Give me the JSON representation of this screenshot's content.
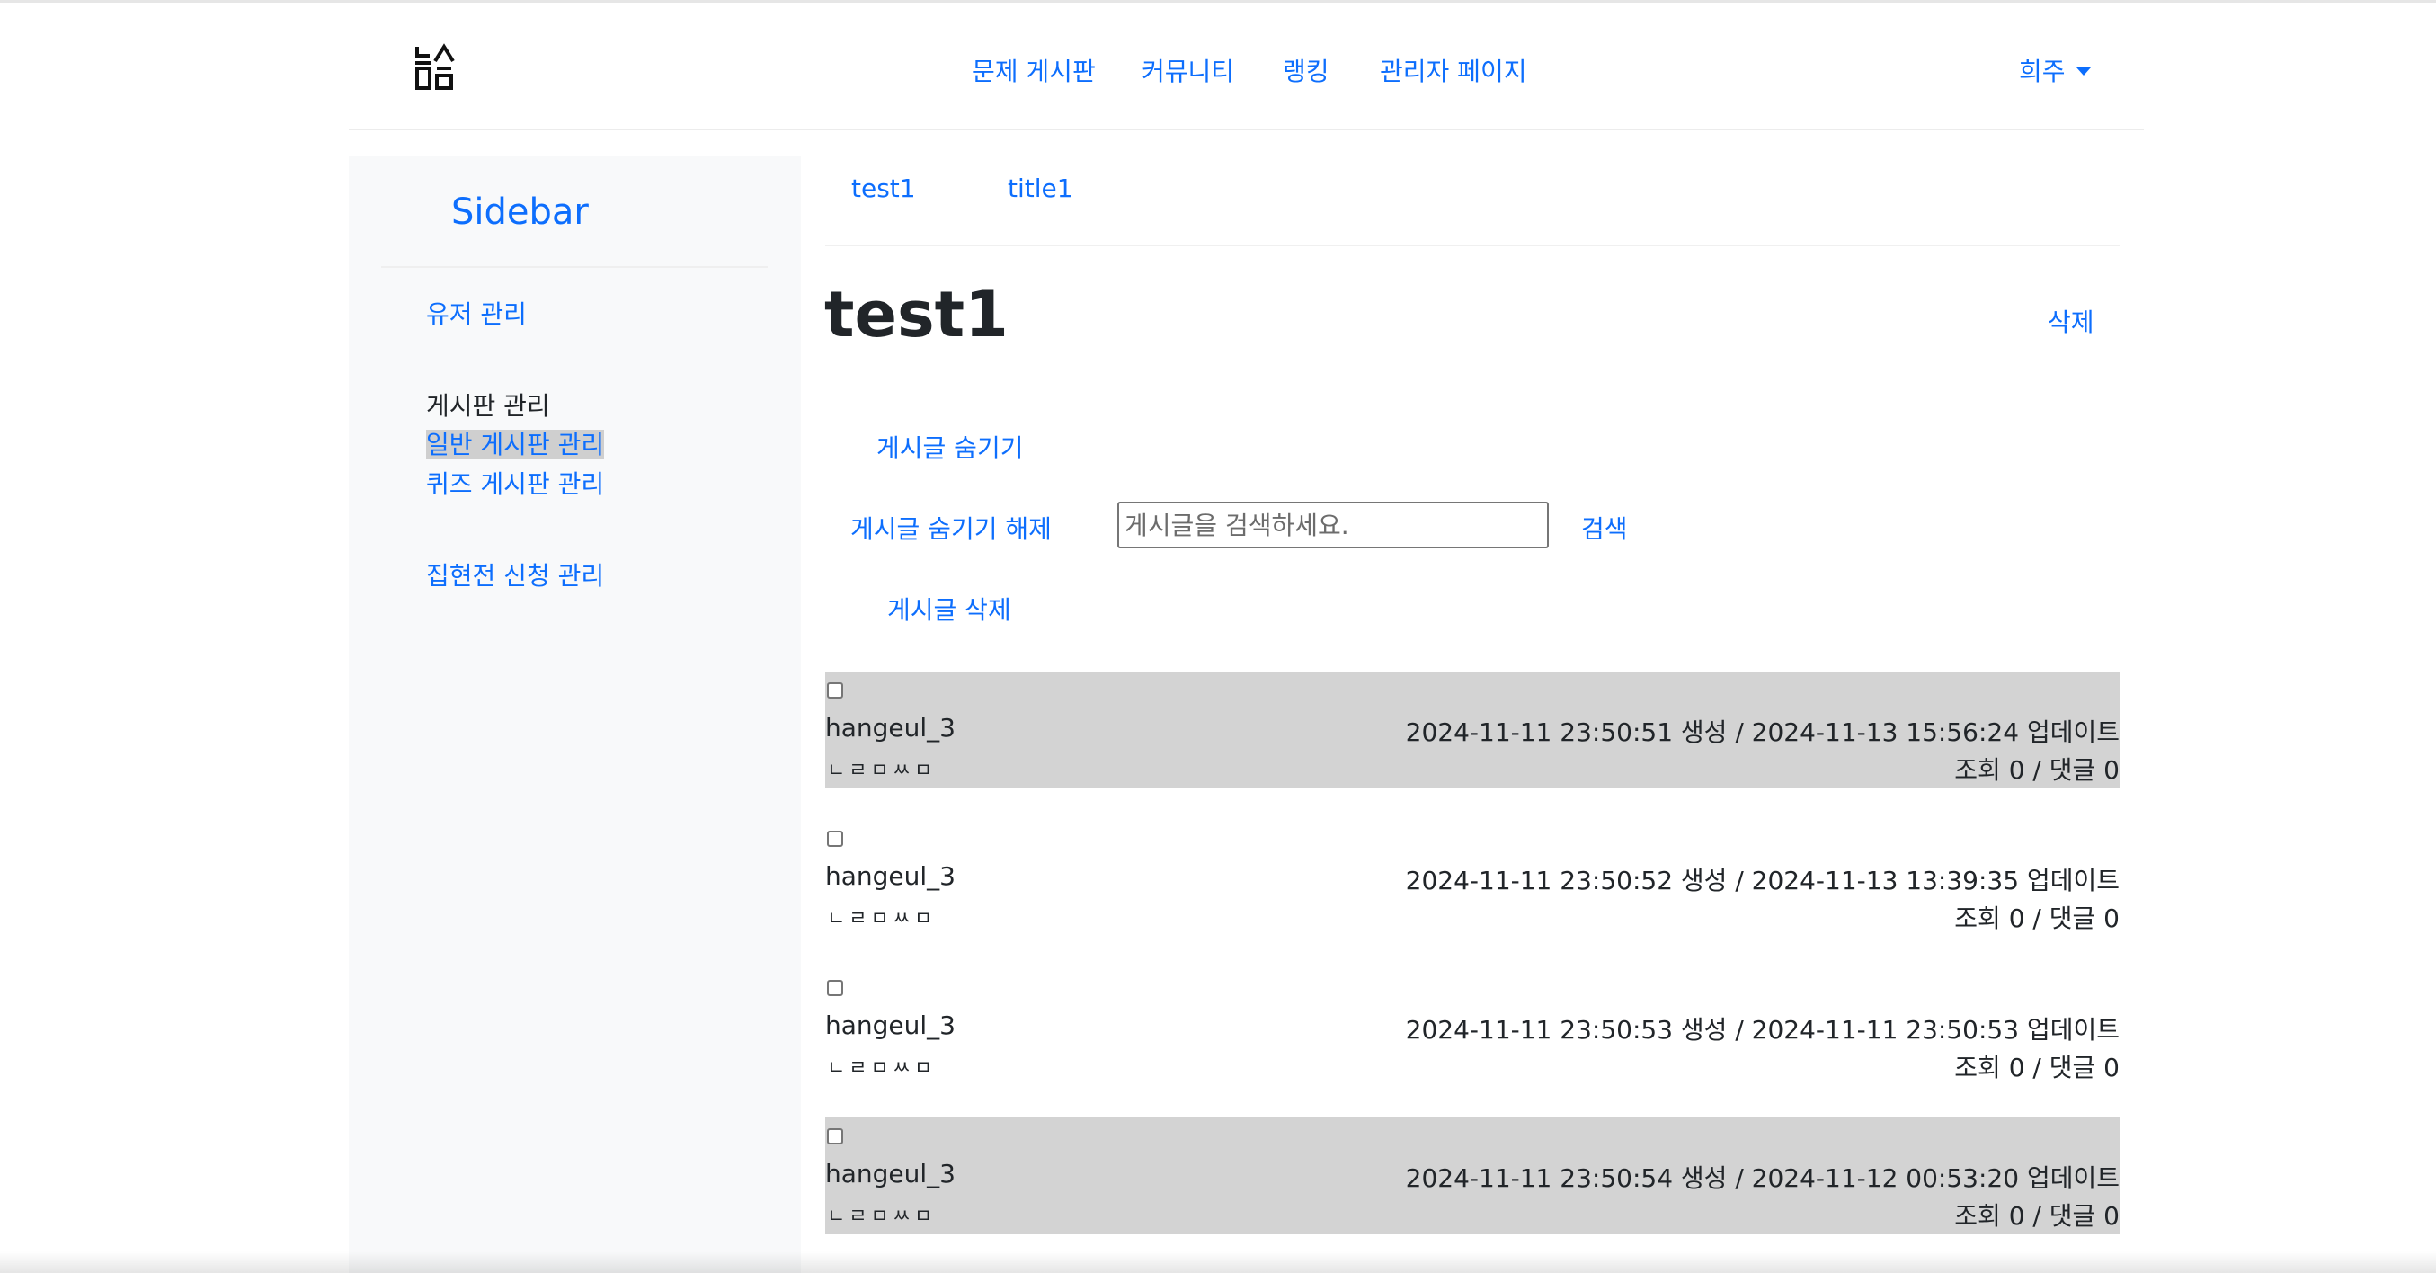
{
  "header": {
    "logo_icon": "hangul-building-logo",
    "nav": [
      {
        "label": "문제 게시판"
      },
      {
        "label": "커뮤니티"
      },
      {
        "label": "랭킹"
      },
      {
        "label": "관리자 페이지"
      }
    ],
    "user": {
      "label": "희주",
      "icon": "caret-down-icon"
    }
  },
  "sidebar": {
    "title": "Sidebar",
    "user_manage": "유저 관리",
    "board_heading": "게시판 관리",
    "general_board": "일반 게시판 관리",
    "quiz_board": "퀴즈 게시판 관리",
    "challenge_manage": "집현전 신청 관리"
  },
  "breadcrumb": {
    "first": "test1",
    "second": "title1"
  },
  "page": {
    "title": "test1",
    "delete_label": "삭제"
  },
  "actions": {
    "hide": "게시글 숨기기",
    "unhide": "게시글 숨기기 해제",
    "search_placeholder": "게시글을 검색하세요.",
    "search_button": "검색",
    "delete_posts": "게시글 삭제"
  },
  "posts": [
    {
      "author": "hangeul_3",
      "title": "ㄴㄹㅁㅆㅁ",
      "dates": "2024-11-11 23:50:51 생성 / 2024-11-13 15:56:24 업데이트",
      "stats": "조회 0 / 댓글 0",
      "highlighted": true
    },
    {
      "author": "hangeul_3",
      "title": "ㄴㄹㅁㅆㅁ",
      "dates": "2024-11-11 23:50:52 생성 / 2024-11-13 13:39:35 업데이트",
      "stats": "조회 0 / 댓글 0",
      "highlighted": false
    },
    {
      "author": "hangeul_3",
      "title": "ㄴㄹㅁㅆㅁ",
      "dates": "2024-11-11 23:50:53 생성 / 2024-11-11 23:50:53 업데이트",
      "stats": "조회 0 / 댓글 0",
      "highlighted": false
    },
    {
      "author": "hangeul_3",
      "title": "ㄴㄹㅁㅆㅁ",
      "dates": "2024-11-11 23:50:54 생성 / 2024-11-12 00:53:20 업데이트",
      "stats": "조회 0 / 댓글 0",
      "highlighted": true
    }
  ],
  "colors": {
    "accent": "#0d6efd",
    "row_highlight": "#d3d3d3",
    "sidebar_bg": "#f8f9fa"
  }
}
